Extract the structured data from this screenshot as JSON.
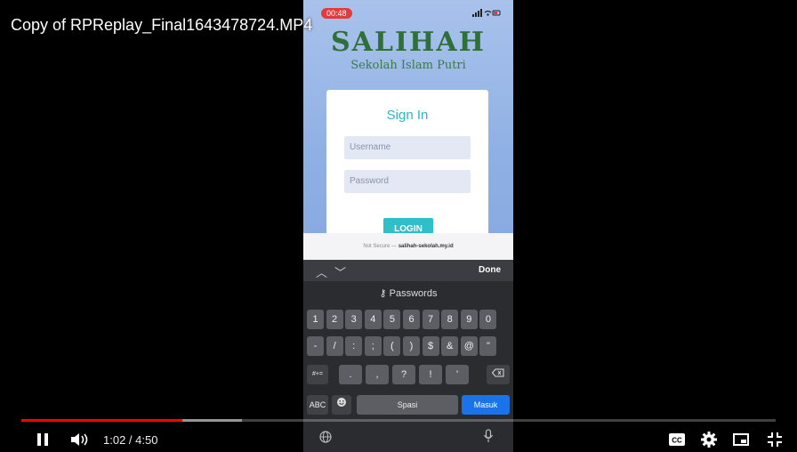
{
  "video": {
    "title": "Copy of RPReplay_Final1643478724.MP4",
    "current_time": "1:02",
    "duration": "4:50",
    "time_display": "1:02 / 4:50",
    "progress_fraction": 0.214,
    "buffered_fraction": 0.292,
    "colors": {
      "progress": "#ff0000"
    }
  },
  "phone": {
    "status_time": "00:48",
    "status_icons": "signal-wifi-battery",
    "logo_title": "SALIHAH",
    "logo_subtitle": "Sekolah Islam Putri",
    "signin_title": "Sign In",
    "username_placeholder": "Username",
    "password_placeholder": "Password",
    "login_label": "LOGIN",
    "url_prefix": "Not Secure —",
    "url": "salihah-sekolah.my.id",
    "toolbar_done": "Done",
    "passwords_label": "Passwords",
    "keyboard": {
      "row1": [
        "1",
        "2",
        "3",
        "4",
        "5",
        "6",
        "7",
        "8",
        "9",
        "0"
      ],
      "row2": [
        "-",
        "/",
        ":",
        ";",
        "(",
        ")",
        "$",
        "&",
        "@",
        "\""
      ],
      "row3": [
        "#+=",
        ".",
        ",",
        "?",
        "!",
        "'"
      ],
      "abc_label": "ABC",
      "space_label": "Spasi",
      "return_label": "Masuk"
    }
  }
}
